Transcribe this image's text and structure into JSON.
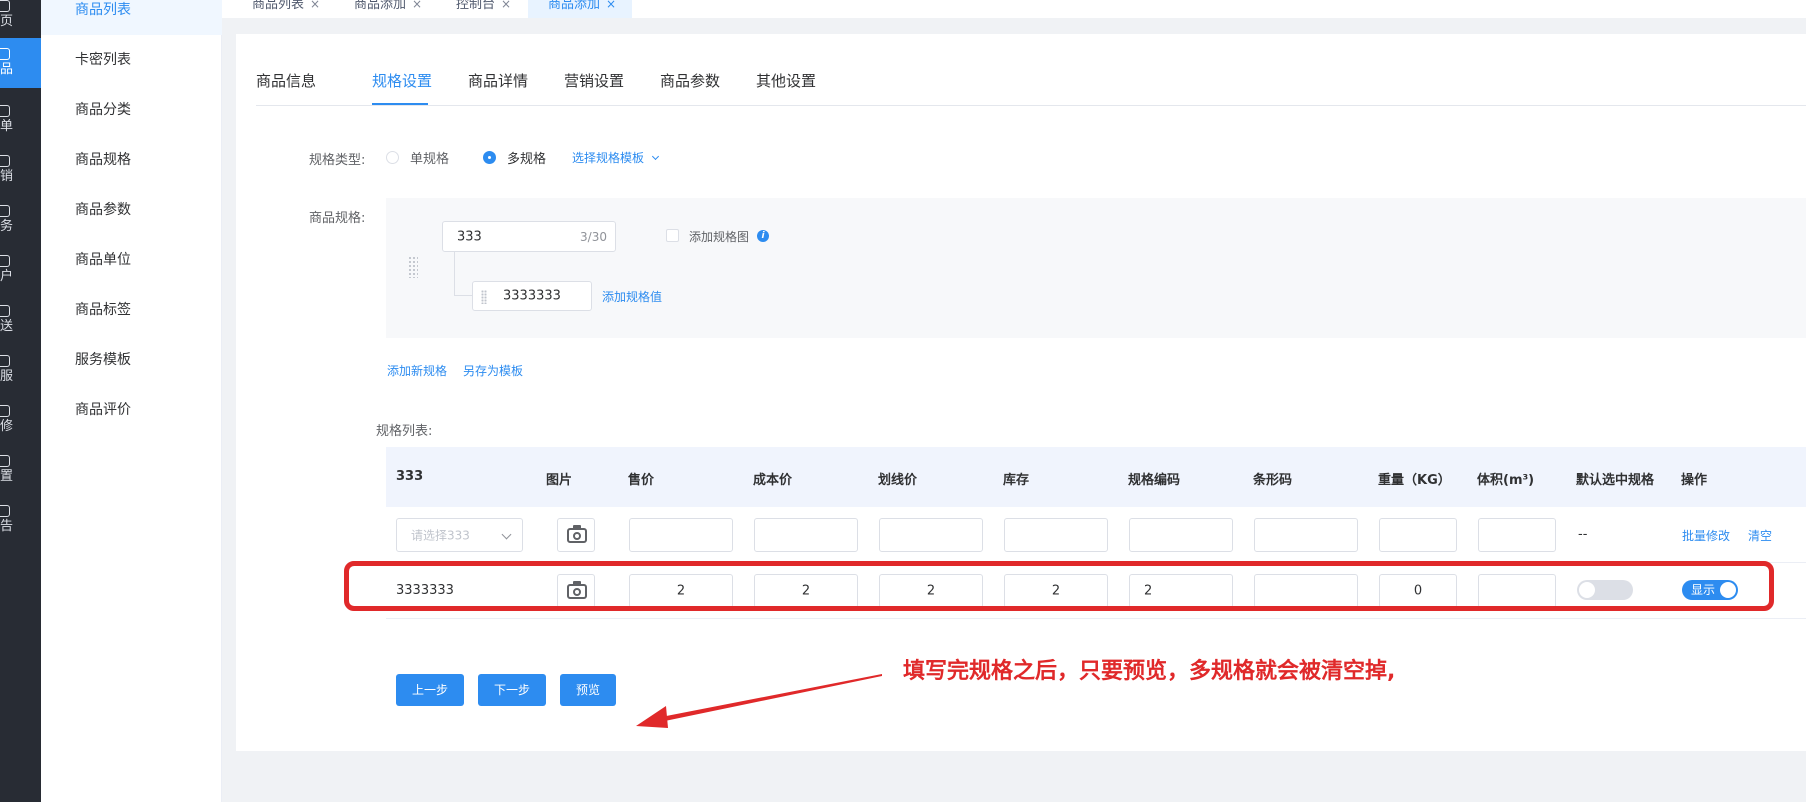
{
  "rail": {
    "items": [
      {
        "label": "页",
        "active": false
      },
      {
        "label": "品",
        "active": true
      },
      {
        "label": "单",
        "active": false
      },
      {
        "label": "销",
        "active": false
      },
      {
        "label": "务",
        "active": false
      },
      {
        "label": "户",
        "active": false
      },
      {
        "label": "送",
        "active": false
      },
      {
        "label": "服",
        "active": false
      },
      {
        "label": "修",
        "active": false
      },
      {
        "label": "置",
        "active": false
      },
      {
        "label": "告",
        "active": false
      }
    ]
  },
  "submenu": {
    "items": [
      "商品列表",
      "卡密列表",
      "商品分类",
      "商品规格",
      "商品参数",
      "商品单位",
      "商品标签",
      "服务模板",
      "商品评价"
    ],
    "active_index": 0
  },
  "tabs": [
    {
      "label": "商品列表",
      "close": "×"
    },
    {
      "label": "商品添加",
      "close": "×"
    },
    {
      "label": "控制台",
      "close": "×"
    },
    {
      "label": "商品添加",
      "close": "×"
    }
  ],
  "steps": [
    "商品信息",
    "规格设置",
    "商品详情",
    "营销设置",
    "商品参数",
    "其他设置"
  ],
  "form": {
    "spec_type_label": "规格类型:",
    "single_spec": "单规格",
    "multi_spec": "多规格",
    "choose_template": "选择规格模板",
    "product_spec_label": "商品规格:",
    "spec_name_value": "333",
    "spec_name_count": "3/30",
    "add_spec_image": "添加规格图",
    "spec_value": "3333333",
    "add_spec_value": "添加规格值",
    "add_new_spec": "添加新规格",
    "save_as_template": "另存为模板",
    "spec_list_label": "规格列表:"
  },
  "table": {
    "headers": [
      "333",
      "图片",
      "售价",
      "成本价",
      "划线价",
      "库存",
      "规格编码",
      "条形码",
      "重量（KG）",
      "体积(m³)",
      "默认选中规格",
      "操作"
    ],
    "batch_row": {
      "select_placeholder": "请选择333",
      "default_cell": "--",
      "batch_edit": "批量修改",
      "clear": "清空"
    },
    "rows": [
      {
        "spec": "3333333",
        "price": "2",
        "cost": "2",
        "line_price": "2",
        "stock": "2",
        "code": "2",
        "barcode": "",
        "weight": "0",
        "volume": "",
        "show_label": "显示"
      }
    ]
  },
  "buttons": {
    "prev": "上一步",
    "next": "下一步",
    "preview": "预览"
  },
  "annotation": "填写完规格之后，只要预览，多规格就会被清空掉,",
  "colors": {
    "primary": "#2d8cf0",
    "annotation_red": "#e0292a",
    "rail_bg": "#282c34"
  }
}
